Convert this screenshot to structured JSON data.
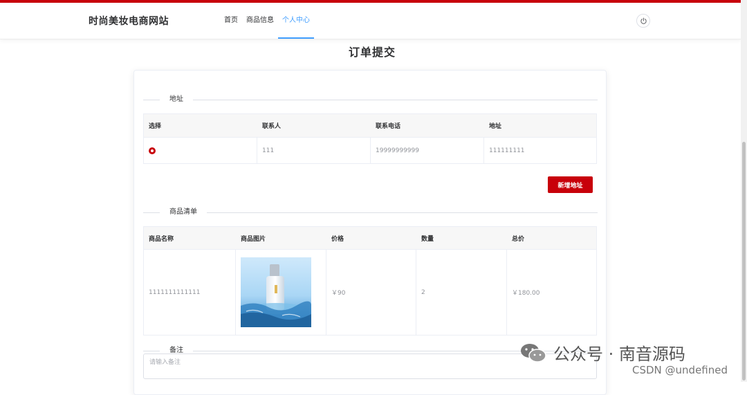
{
  "header": {
    "brand": "时尚美妆电商网站",
    "nav": [
      {
        "label": "首页",
        "active": false
      },
      {
        "label": "商品信息",
        "active": false
      },
      {
        "label": "个人中心",
        "active": true
      }
    ]
  },
  "page": {
    "title": "订单提交"
  },
  "address_section": {
    "label": "地址",
    "columns": [
      "选择",
      "联系人",
      "联系电话",
      "地址"
    ],
    "rows": [
      {
        "selected": true,
        "contact": "111",
        "phone": "19999999999",
        "address": "111111111"
      }
    ],
    "add_button": "新增地址"
  },
  "goods_section": {
    "label": "商品清单",
    "columns": [
      "商品名称",
      "商品图片",
      "价格",
      "数量",
      "总价"
    ],
    "rows": [
      {
        "name": "1111111111111",
        "image": "product-bottle",
        "price": "￥90",
        "quantity": "2",
        "total": "￥180.00"
      }
    ]
  },
  "remark_section": {
    "label": "备注",
    "placeholder": "请输入备注",
    "value": ""
  },
  "watermark": {
    "text": "公众号 · 南音源码",
    "csdn": "CSDN @undefined"
  },
  "colors": {
    "accent": "#c8000a",
    "nav_active": "#409eff"
  }
}
